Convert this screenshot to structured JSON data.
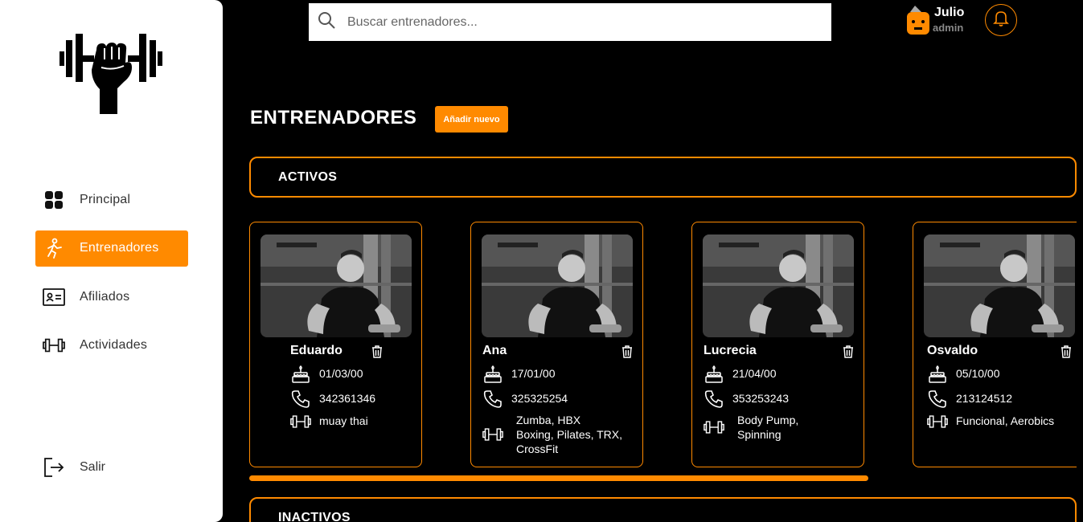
{
  "colors": {
    "accent": "#ff8a00",
    "background": "#000000",
    "sidebar": "#ffffff"
  },
  "sidebar": {
    "items": [
      {
        "label": "Principal",
        "icon": "grid-icon",
        "active": false
      },
      {
        "label": "Entrenadores",
        "icon": "runner-icon",
        "active": true
      },
      {
        "label": "Afiliados",
        "icon": "id-card-icon",
        "active": false
      },
      {
        "label": "Actividades",
        "icon": "dumbbell-icon",
        "active": false
      }
    ],
    "logout_label": "Salir"
  },
  "search": {
    "placeholder": "Buscar entrenadores..."
  },
  "user": {
    "name": "Julio",
    "role": "admin"
  },
  "page": {
    "title": "ENTRENADORES",
    "add_label": "Añadir nuevo"
  },
  "sections": {
    "active": "ACTIVOS",
    "inactive": "INACTIVOS"
  },
  "trainers": [
    {
      "name": "Eduardo",
      "birthdate": "01/03/00",
      "phone": "342361346",
      "activities": [
        "muay thai"
      ]
    },
    {
      "name": "Ana",
      "birthdate": "17/01/00",
      "phone": "325325254",
      "activities": [
        "Zumba, HBX",
        "Boxing, Pilates, TRX,",
        "CrossFit"
      ]
    },
    {
      "name": "Lucrecia",
      "birthdate": "21/04/00",
      "phone": "353253243",
      "activities": [
        "Body Pump,",
        "Spinning"
      ]
    },
    {
      "name": "Osvaldo",
      "birthdate": "05/10/00",
      "phone": "213124512",
      "activities": [
        "Funcional, Aerobics"
      ]
    }
  ]
}
